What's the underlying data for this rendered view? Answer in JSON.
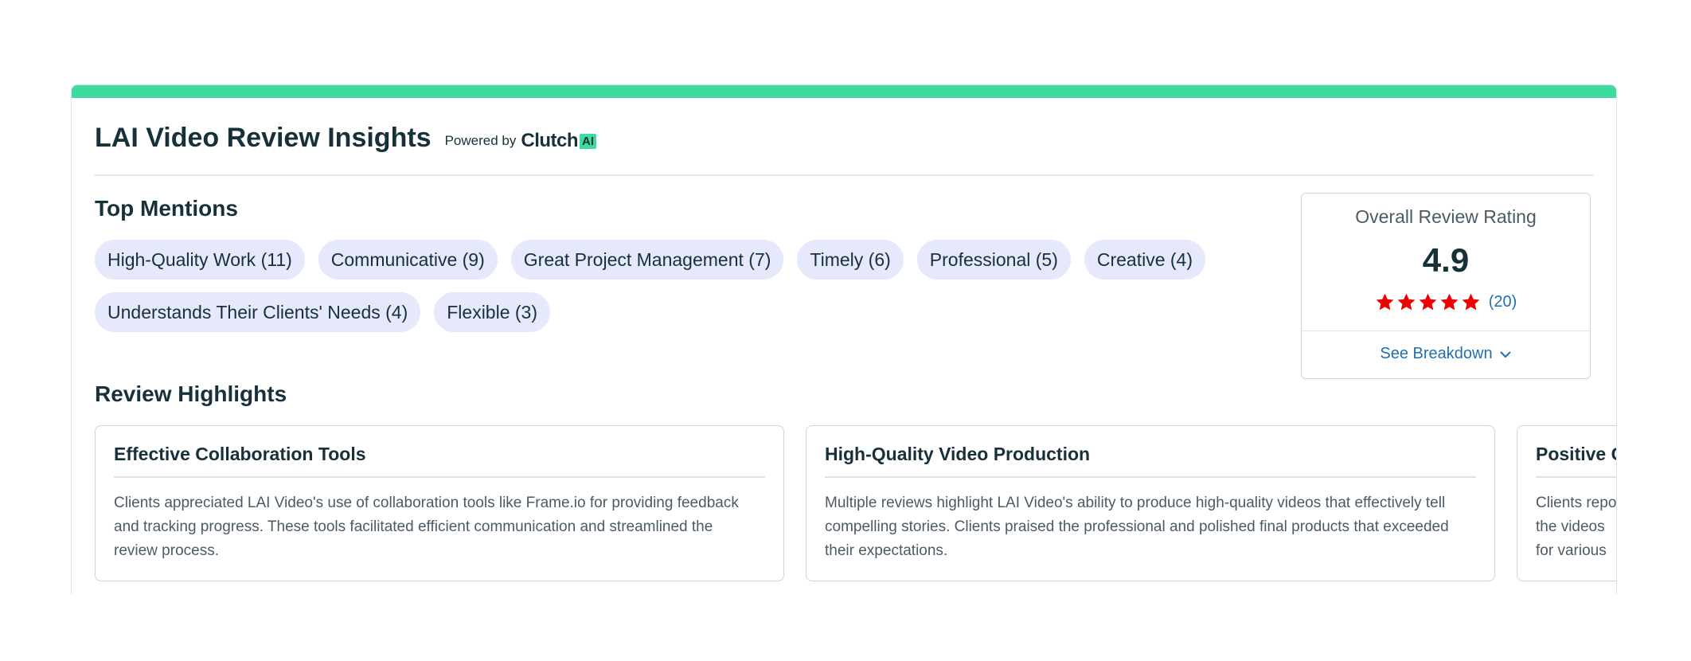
{
  "header": {
    "title": "LAI Video Review Insights",
    "powered_by": "Powered by",
    "brand": "Clutch",
    "brand_badge": "AI"
  },
  "top_mentions": {
    "title": "Top Mentions",
    "chips": [
      {
        "label": "High-Quality Work (11)"
      },
      {
        "label": "Communicative (9)"
      },
      {
        "label": "Great Project Management (7)"
      },
      {
        "label": "Timely (6)"
      },
      {
        "label": "Professional (5)"
      },
      {
        "label": "Creative (4)"
      },
      {
        "label": "Understands Their Clients' Needs (4)"
      },
      {
        "label": "Flexible (3)"
      }
    ]
  },
  "rating": {
    "label": "Overall Review Rating",
    "value": "4.9",
    "stars": 5,
    "count": "(20)",
    "breakdown_label": "See Breakdown"
  },
  "review_highlights": {
    "title": "Review Highlights",
    "cards": [
      {
        "title": "Effective Collaboration Tools",
        "text": "Clients appreciated LAI Video's use of collaboration tools like Frame.io for providing feedback and tracking progress. These tools facilitated efficient communication and streamlined the review process."
      },
      {
        "title": "High-Quality Video Production",
        "text": "Multiple reviews highlight LAI Video's ability to produce high-quality videos that effectively tell compelling stories. Clients praised the professional and polished final products that exceeded their expectations."
      },
      {
        "title": "Positive C",
        "text": "Clients repo the videos for various"
      }
    ]
  },
  "colors": {
    "accent": "#3ddc9e",
    "chip_bg": "#e6e8fb",
    "star": "#ee0000",
    "link": "#1f6fb2",
    "text": "#17313b"
  }
}
